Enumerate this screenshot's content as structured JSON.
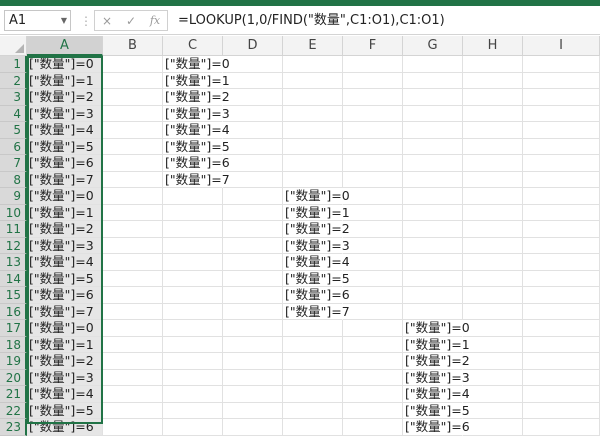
{
  "formula_bar": {
    "name_box": "A1",
    "cancel_icon": "×",
    "enter_icon": "✓",
    "fx_label": "fx",
    "formula": "=LOOKUP(1,0/FIND(\"数量\",C1:O1),C1:O1)"
  },
  "columns": [
    "A",
    "B",
    "C",
    "D",
    "E",
    "F",
    "G",
    "H",
    "I"
  ],
  "rows": [
    {
      "num": "1",
      "A": "[\"数量\"]=0",
      "C": "[\"数量\"]=0",
      "E": "",
      "G": ""
    },
    {
      "num": "2",
      "A": "[\"数量\"]=1",
      "C": "[\"数量\"]=1",
      "E": "",
      "G": ""
    },
    {
      "num": "3",
      "A": "[\"数量\"]=2",
      "C": "[\"数量\"]=2",
      "E": "",
      "G": ""
    },
    {
      "num": "4",
      "A": "[\"数量\"]=3",
      "C": "[\"数量\"]=3",
      "E": "",
      "G": ""
    },
    {
      "num": "5",
      "A": "[\"数量\"]=4",
      "C": "[\"数量\"]=4",
      "E": "",
      "G": ""
    },
    {
      "num": "6",
      "A": "[\"数量\"]=5",
      "C": "[\"数量\"]=5",
      "E": "",
      "G": ""
    },
    {
      "num": "7",
      "A": "[\"数量\"]=6",
      "C": "[\"数量\"]=6",
      "E": "",
      "G": ""
    },
    {
      "num": "8",
      "A": "[\"数量\"]=7",
      "C": "[\"数量\"]=7",
      "E": "",
      "G": ""
    },
    {
      "num": "9",
      "A": "[\"数量\"]=0",
      "C": "",
      "E": "[\"数量\"]=0",
      "G": ""
    },
    {
      "num": "10",
      "A": "[\"数量\"]=1",
      "C": "",
      "E": "[\"数量\"]=1",
      "G": ""
    },
    {
      "num": "11",
      "A": "[\"数量\"]=2",
      "C": "",
      "E": "[\"数量\"]=2",
      "G": ""
    },
    {
      "num": "12",
      "A": "[\"数量\"]=3",
      "C": "",
      "E": "[\"数量\"]=3",
      "G": ""
    },
    {
      "num": "13",
      "A": "[\"数量\"]=4",
      "C": "",
      "E": "[\"数量\"]=4",
      "G": ""
    },
    {
      "num": "14",
      "A": "[\"数量\"]=5",
      "C": "",
      "E": "[\"数量\"]=5",
      "G": ""
    },
    {
      "num": "15",
      "A": "[\"数量\"]=6",
      "C": "",
      "E": "[\"数量\"]=6",
      "G": ""
    },
    {
      "num": "16",
      "A": "[\"数量\"]=7",
      "C": "",
      "E": "[\"数量\"]=7",
      "G": ""
    },
    {
      "num": "17",
      "A": "[\"数量\"]=0",
      "C": "",
      "E": "",
      "G": "[\"数量\"]=0"
    },
    {
      "num": "18",
      "A": "[\"数量\"]=1",
      "C": "",
      "E": "",
      "G": "[\"数量\"]=1"
    },
    {
      "num": "19",
      "A": "[\"数量\"]=2",
      "C": "",
      "E": "",
      "G": "[\"数量\"]=2"
    },
    {
      "num": "20",
      "A": "[\"数量\"]=3",
      "C": "",
      "E": "",
      "G": "[\"数量\"]=3"
    },
    {
      "num": "21",
      "A": "[\"数量\"]=4",
      "C": "",
      "E": "",
      "G": "[\"数量\"]=4"
    },
    {
      "num": "22",
      "A": "[\"数量\"]=5",
      "C": "",
      "E": "",
      "G": "[\"数量\"]=5"
    },
    {
      "num": "23",
      "A": "[\"数量\"]=6",
      "C": "",
      "E": "",
      "G": "[\"数量\"]=6"
    }
  ],
  "colors": {
    "accent": "#217346"
  }
}
